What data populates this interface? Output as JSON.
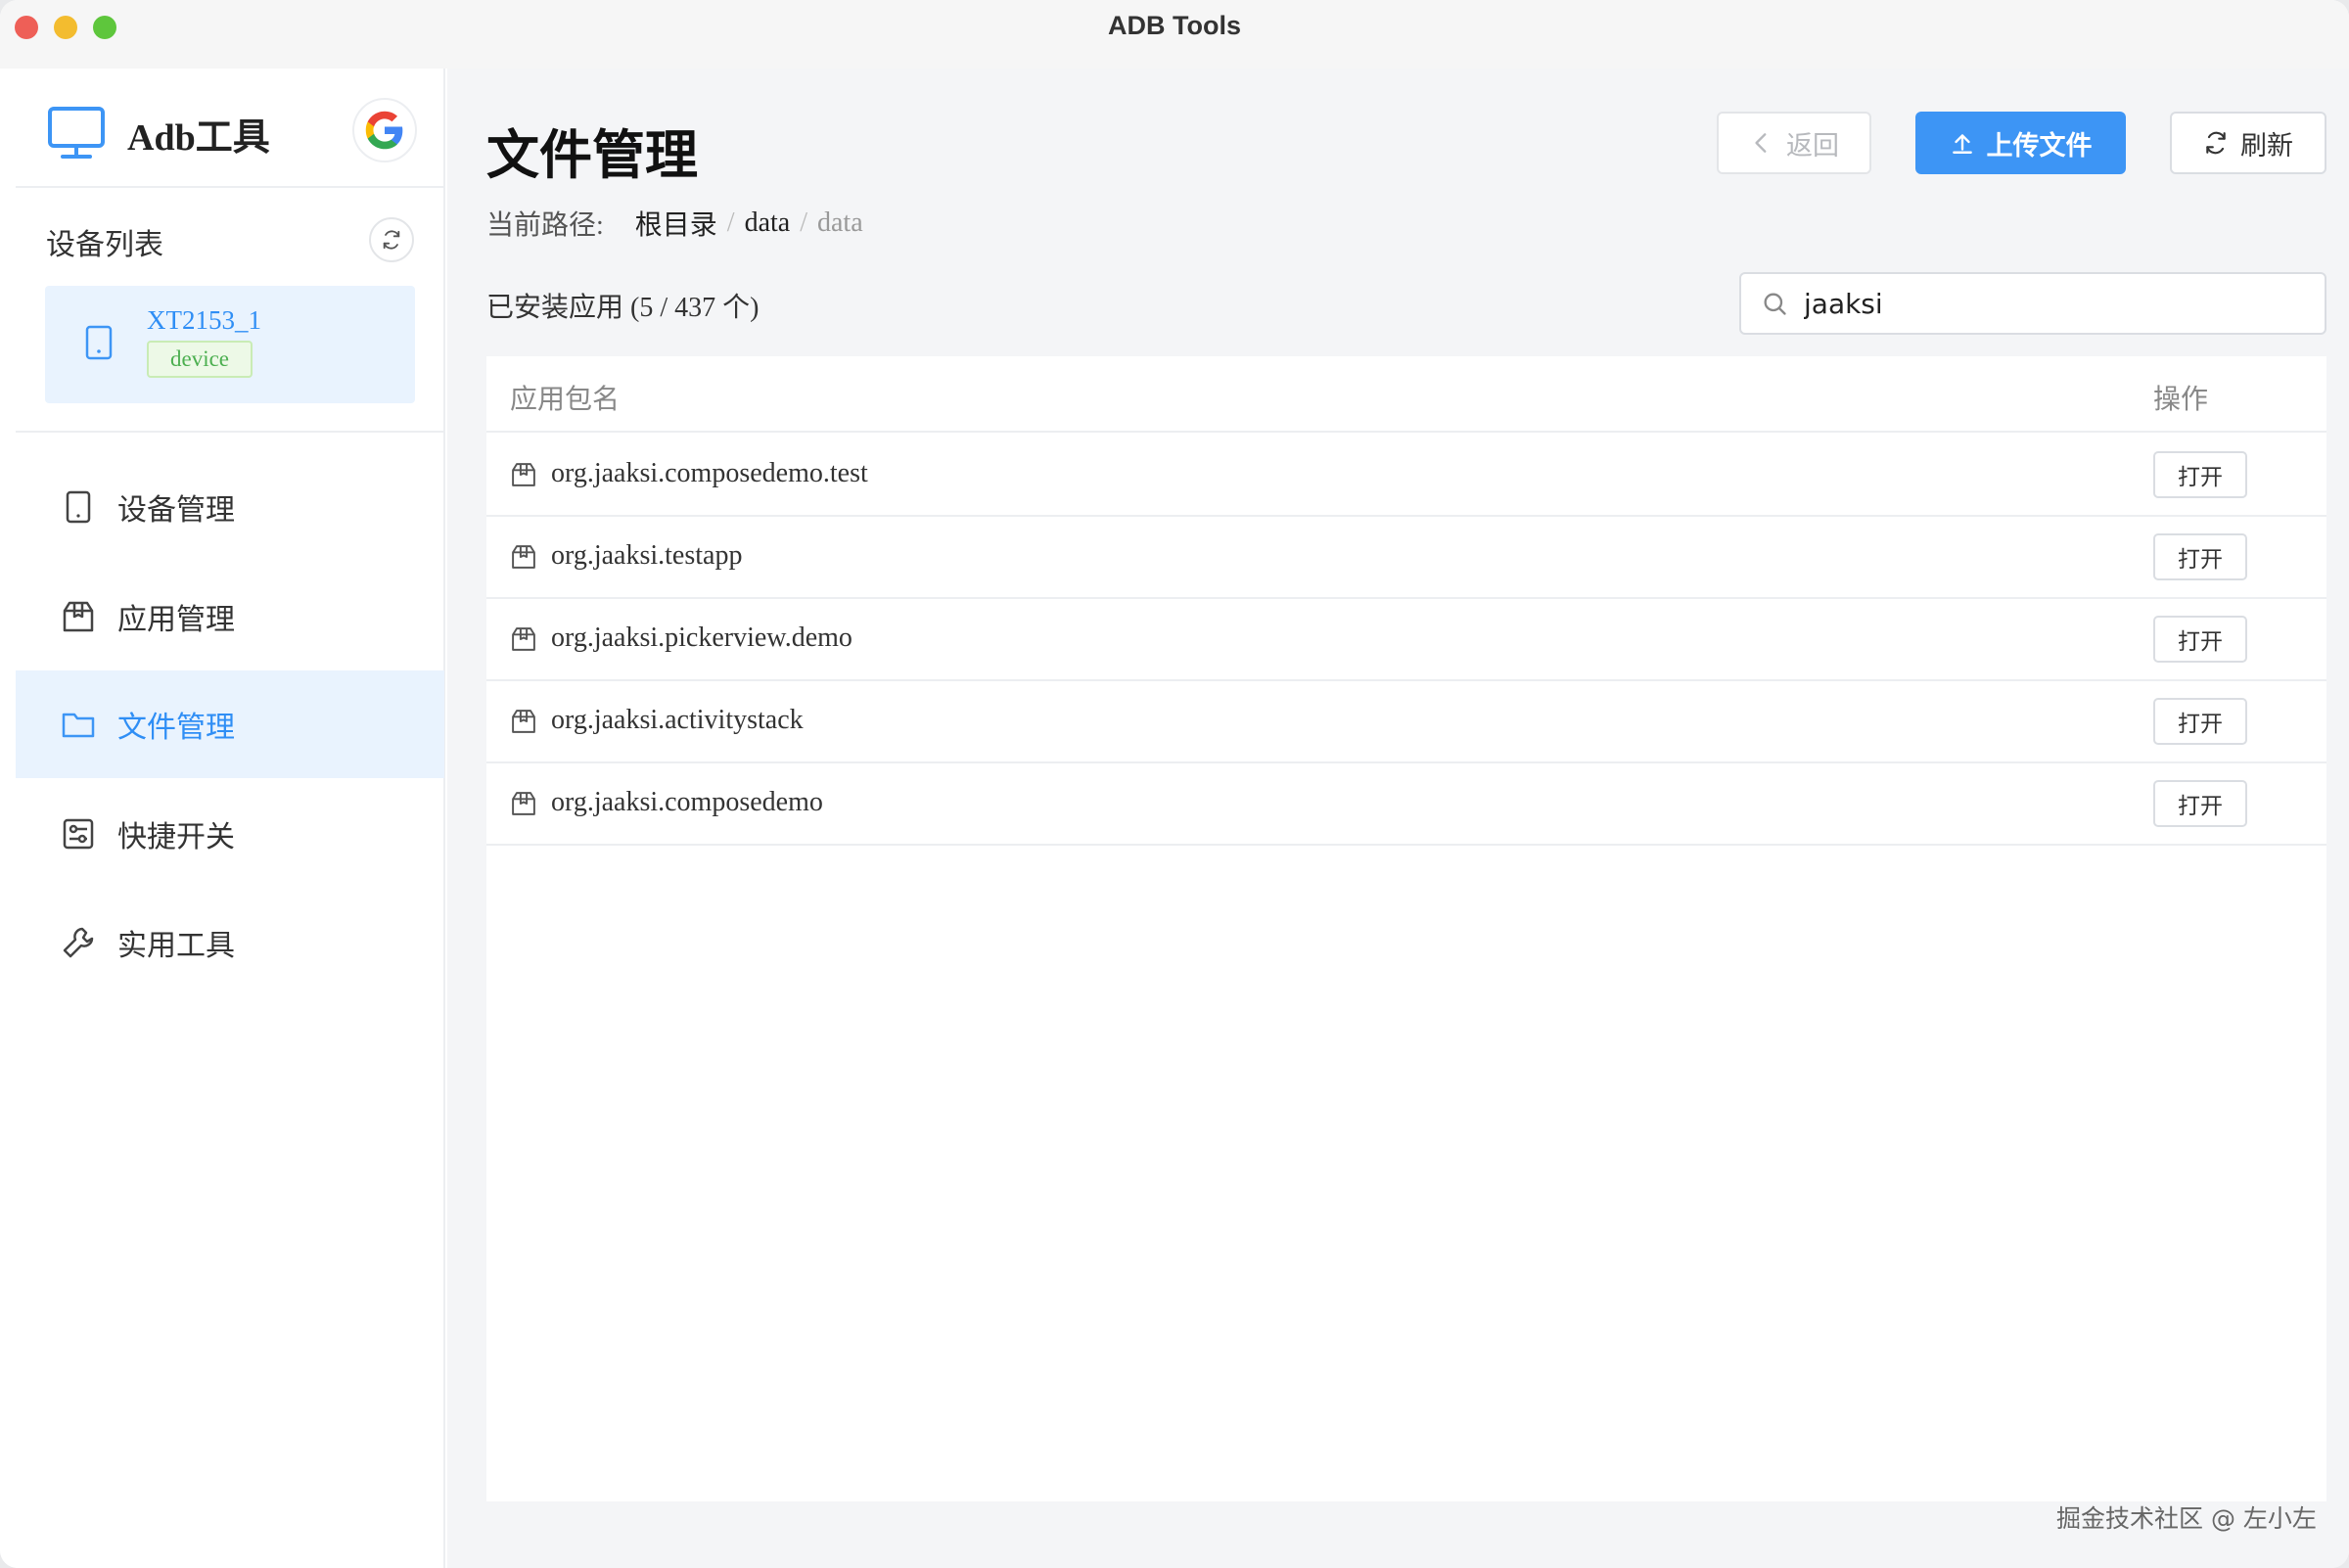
{
  "window": {
    "title": "ADB Tools"
  },
  "sidebar": {
    "brand": "Adb工具",
    "device_list_title": "设备列表",
    "device": {
      "name": "XT2153_1",
      "tag": "device"
    },
    "nav": [
      {
        "label": "设备管理",
        "icon": "tablet-icon",
        "active": false
      },
      {
        "label": "应用管理",
        "icon": "package-icon",
        "active": false
      },
      {
        "label": "文件管理",
        "icon": "folder-icon",
        "active": true
      },
      {
        "label": "快捷开关",
        "icon": "switch-panel-icon",
        "active": false
      },
      {
        "label": "实用工具",
        "icon": "wrench-icon",
        "active": false
      }
    ]
  },
  "main": {
    "title": "文件管理",
    "buttons": {
      "back": "返回",
      "upload": "上传文件",
      "refresh": "刷新"
    },
    "breadcrumb": {
      "label": "当前路径:",
      "items": [
        "根目录",
        "data",
        "data"
      ]
    },
    "count": "已安装应用 (5 / 437 个)",
    "search": {
      "value": "jaaksi",
      "placeholder": ""
    },
    "table": {
      "headers": {
        "name": "应用包名",
        "action": "操作"
      },
      "rows": [
        {
          "pkg": "org.jaaksi.composedemo.test",
          "action": "打开"
        },
        {
          "pkg": "org.jaaksi.testapp",
          "action": "打开"
        },
        {
          "pkg": "org.jaaksi.pickerview.demo",
          "action": "打开"
        },
        {
          "pkg": "org.jaaksi.activitystack",
          "action": "打开"
        },
        {
          "pkg": "org.jaaksi.composedemo",
          "action": "打开"
        }
      ]
    }
  },
  "watermark": "掘金技术社区 @ 左小左",
  "colors": {
    "accent": "#3d95f5",
    "active_bg": "#e9f3fe",
    "tag_green": "#4caf50"
  }
}
